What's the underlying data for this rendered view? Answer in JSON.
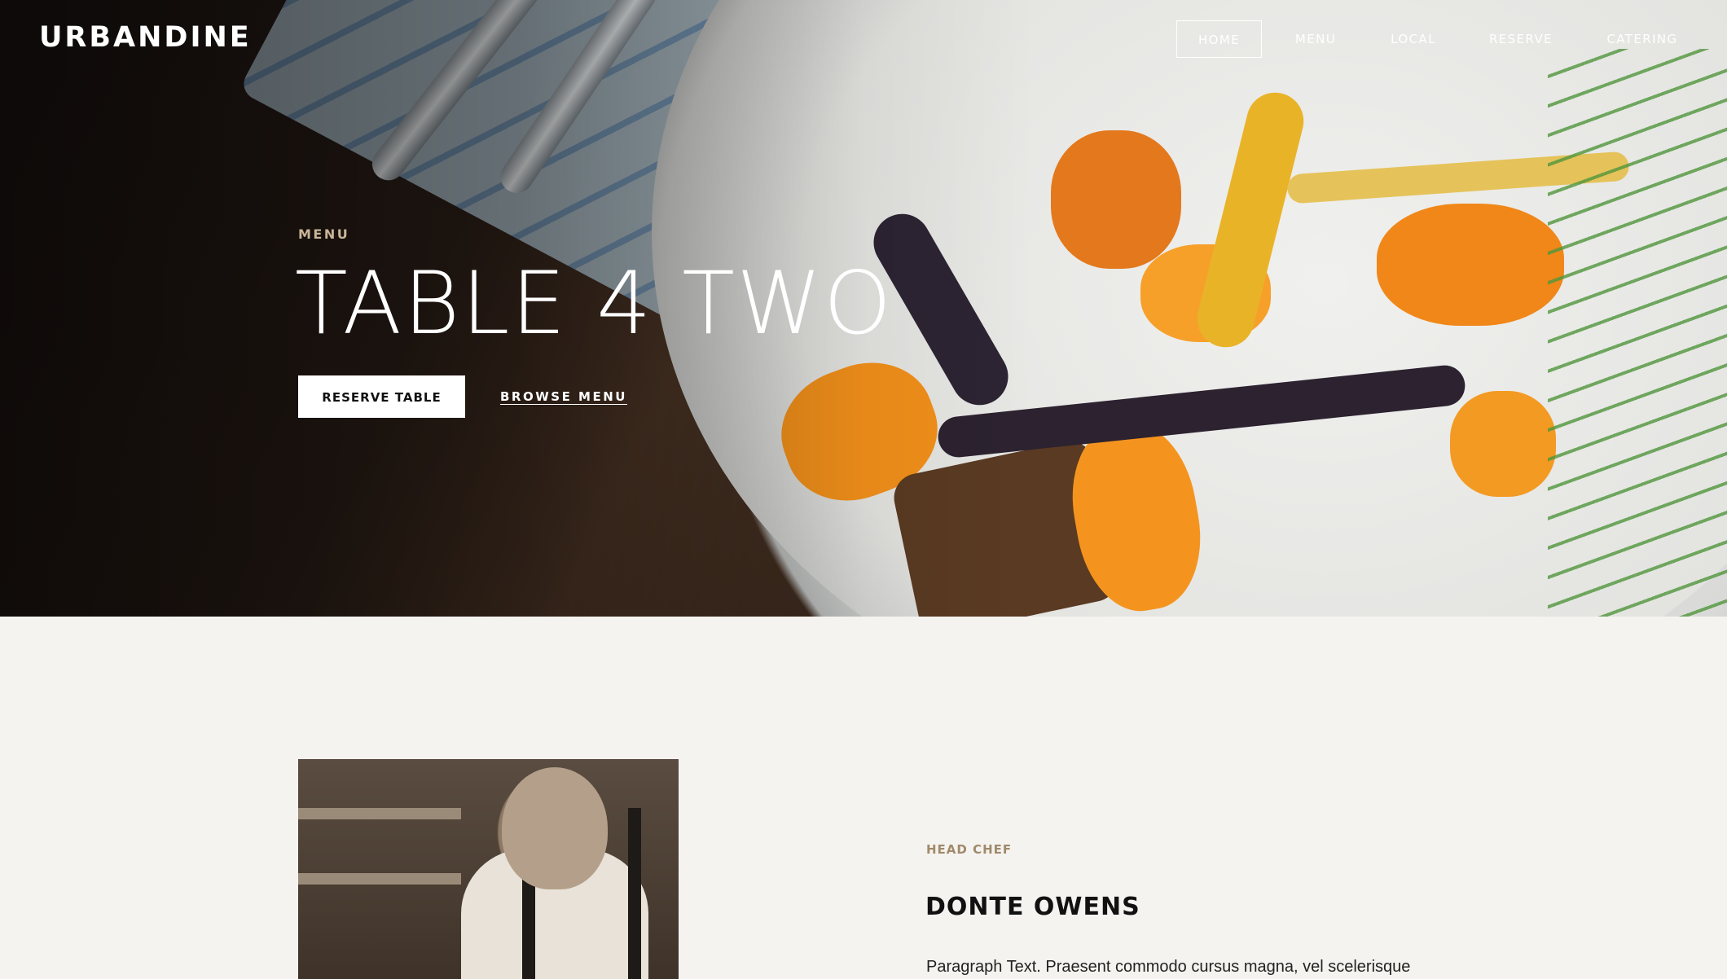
{
  "header": {
    "logo": "URBANDINE",
    "nav": [
      {
        "label": "HOME",
        "active": true
      },
      {
        "label": "MENU",
        "active": false
      },
      {
        "label": "LOCAL",
        "active": false
      },
      {
        "label": "RESERVE",
        "active": false
      },
      {
        "label": "CATERING",
        "active": false
      }
    ]
  },
  "hero": {
    "kicker": "MENU",
    "title": "TABLE 4 TWO",
    "primary_button": "RESERVE TABLE",
    "secondary_link": "BROWSE MENU"
  },
  "chef": {
    "kicker": "HEAD CHEF",
    "name": "DONTE OWENS",
    "paragraph": "Paragraph Text. Praesent commodo cursus magna, vel scelerisque"
  },
  "colors": {
    "accent": "#a08a6a",
    "page_background": "#f5f3f0"
  }
}
